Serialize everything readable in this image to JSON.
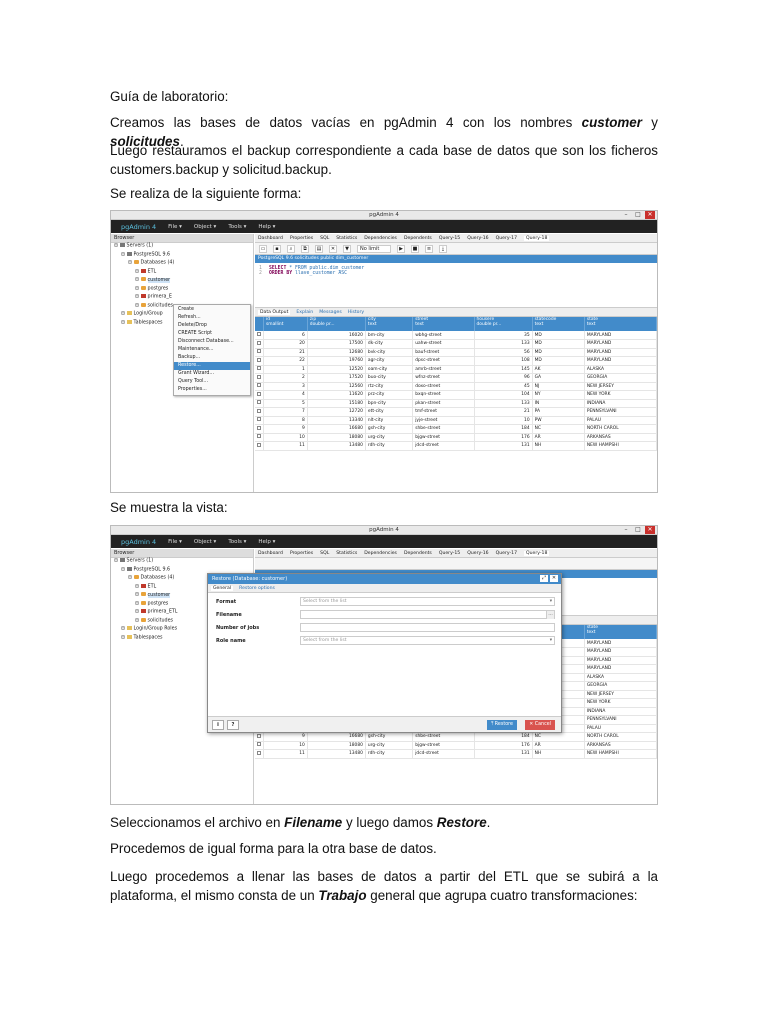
{
  "doc": {
    "p1": "Guía de laboratorio:",
    "p2_a": "Creamos las bases de datos vacías en pgAdmin 4 con los nombres ",
    "p2_b": "customer",
    "p2_c": " y ",
    "p2_d": "solicitudes",
    "p2_e": ".",
    "p3": "Luego restauramos el backup correspondiente a cada base de datos que son los ficheros customers.backup y solicitud.backup.",
    "p4": "Se realiza de la siguiente forma:",
    "p5": "Se muestra la vista:",
    "p6_a": "Seleccionamos el archivo en ",
    "p6_b": "Filename",
    "p6_c": " y luego damos ",
    "p6_d": "Restore",
    "p6_e": ".",
    "p7": "Procedemos de igual forma para la otra base de datos.",
    "p8_a": "Luego procedemos a llenar las bases de datos a partir del ETL que se subirá a la plataforma, el mismo consta de un ",
    "p8_b": "Trabajo",
    "p8_c": " general que agrupa cuatro transformaciones:"
  },
  "app": {
    "window_title": "pgAdmin 4",
    "brand": "pgAdmin 4",
    "menu": [
      "File ▾",
      "Object ▾",
      "Tools ▾",
      "Help ▾"
    ],
    "browser_label": "Browser",
    "tabs": [
      "Dashboard",
      "Properties",
      "SQL",
      "Statistics",
      "Dependencies",
      "Dependents",
      "Query-15",
      "Query-16",
      "Query-17",
      "Query-18"
    ],
    "no_limit": "No limit",
    "path": "PostgreSQL 9.6 solicitudes public dim_customer",
    "sql_line1_kw": "SELECT",
    "sql_line1_rest": " * FROM public.dim_customer",
    "sql_line2_kw": "ORDER BY",
    "sql_line2_rest": " llave_customer ASC",
    "result_tabs": [
      "Data Output",
      "Explain",
      "Messages",
      "History"
    ]
  },
  "tree1": [
    {
      "label": "Servers (1)",
      "indent": 0,
      "icon": "srv"
    },
    {
      "label": "PostgreSQL 9.6",
      "indent": 1,
      "icon": "srv"
    },
    {
      "label": "Databases (4)",
      "indent": 2,
      "icon": "db"
    },
    {
      "label": "ETL",
      "indent": 3,
      "icon": "dbx"
    },
    {
      "label": "customer",
      "indent": 3,
      "icon": "db",
      "selected": true
    },
    {
      "label": "postgres",
      "indent": 3,
      "icon": "db"
    },
    {
      "label": "primera_E",
      "indent": 3,
      "icon": "dbx"
    },
    {
      "label": "solicitudes",
      "indent": 3,
      "icon": "db"
    },
    {
      "label": "Login/Group",
      "indent": 1,
      "icon": "fld"
    },
    {
      "label": "Tablespaces",
      "indent": 1,
      "icon": "fld"
    }
  ],
  "tree2": [
    {
      "label": "Servers (1)",
      "indent": 0,
      "icon": "srv"
    },
    {
      "label": "PostgreSQL 9.6",
      "indent": 1,
      "icon": "srv"
    },
    {
      "label": "Databases (4)",
      "indent": 2,
      "icon": "db"
    },
    {
      "label": "ETL",
      "indent": 3,
      "icon": "dbx"
    },
    {
      "label": "customer",
      "indent": 3,
      "icon": "db",
      "selected": true
    },
    {
      "label": "postgres",
      "indent": 3,
      "icon": "db"
    },
    {
      "label": "primera_ETL",
      "indent": 3,
      "icon": "dbx"
    },
    {
      "label": "solicitudes",
      "indent": 3,
      "icon": "db"
    },
    {
      "label": "Login/Group Roles",
      "indent": 1,
      "icon": "fld"
    },
    {
      "label": "Tablespaces",
      "indent": 1,
      "icon": "fld"
    }
  ],
  "context_menu": [
    "Create",
    "Refresh...",
    "Delete/Drop",
    "CREATE Script",
    "Disconnect Database...",
    "Maintenance...",
    "Backup...",
    "Restore...",
    "Grant Wizard...",
    "Query Tool...",
    "Properties..."
  ],
  "context_highlight": "Restore...",
  "grid": {
    "headers": [
      [
        "id",
        "smallint"
      ],
      [
        "zip",
        "double pr..."
      ],
      [
        "city",
        "text"
      ],
      [
        "street",
        "text"
      ],
      [
        "housere",
        "double pr..."
      ],
      [
        "statecode",
        "text"
      ],
      [
        "state",
        "text"
      ]
    ],
    "rows": [
      [
        "6",
        "16020",
        "bm-city",
        "wbhg-street",
        "35",
        "MD",
        "MARYLAND"
      ],
      [
        "20",
        "17500",
        "dk-city",
        "uahw-street",
        "133",
        "MD",
        "MARYLAND"
      ],
      [
        "21",
        "12680",
        "bvk-city",
        "bauf-street",
        "56",
        "MD",
        "MARYLAND"
      ],
      [
        "22",
        "19760",
        "agr-city",
        "dpsc-street",
        "108",
        "MD",
        "MARYLAND"
      ],
      [
        "1",
        "12520",
        "oam-city",
        "amrb-street",
        "145",
        "AK",
        "ALASKA"
      ],
      [
        "2",
        "17520",
        "buo-city",
        "wfnz-street",
        "96",
        "GA",
        "GEORGIA"
      ],
      [
        "3",
        "12560",
        "rtz-city",
        "doxo-street",
        "45",
        "NJ",
        "NEW JERSEY"
      ],
      [
        "4",
        "11620",
        "prz-city",
        "bxqn-street",
        "104",
        "NY",
        "NEW YORK"
      ],
      [
        "5",
        "15180",
        "bpn-city",
        "pkan-street",
        "133",
        "IN",
        "INDIANA"
      ],
      [
        "7",
        "12720",
        "ett-city",
        "tmf-street",
        "21",
        "PA",
        "PENNSYLVANI"
      ],
      [
        "8",
        "13340",
        "nlt-city",
        "jyje-street",
        "10",
        "PW",
        "PALAU"
      ],
      [
        "9",
        "16680",
        "gsh-city",
        "shbe-street",
        "184",
        "NC",
        "NORTH CAROL"
      ],
      [
        "10",
        "18080",
        "urg-city",
        "bjgw-street",
        "176",
        "AR",
        "ARKANSAS"
      ],
      [
        "11",
        "13480",
        "rdh-city",
        "jdcd-street",
        "131",
        "NH",
        "NEW HAMPSHI"
      ]
    ]
  },
  "dialog": {
    "title": "Restore (Database: customer)",
    "tabs": [
      "General",
      "Restore options"
    ],
    "fields": [
      {
        "label": "Format",
        "value": "Select from the list",
        "type": "select"
      },
      {
        "label": "Filename",
        "value": "",
        "type": "file"
      },
      {
        "label": "Number of jobs",
        "value": "",
        "type": "text"
      },
      {
        "label": "Role name",
        "value": "Select from the list",
        "type": "select"
      }
    ],
    "info_btn": "i",
    "help_btn": "?",
    "restore_btn": "Restore",
    "cancel_btn": "Cancel"
  },
  "colors": {
    "accent": "#428bca",
    "menubar": "#222222",
    "cancel": "#d9534f"
  }
}
